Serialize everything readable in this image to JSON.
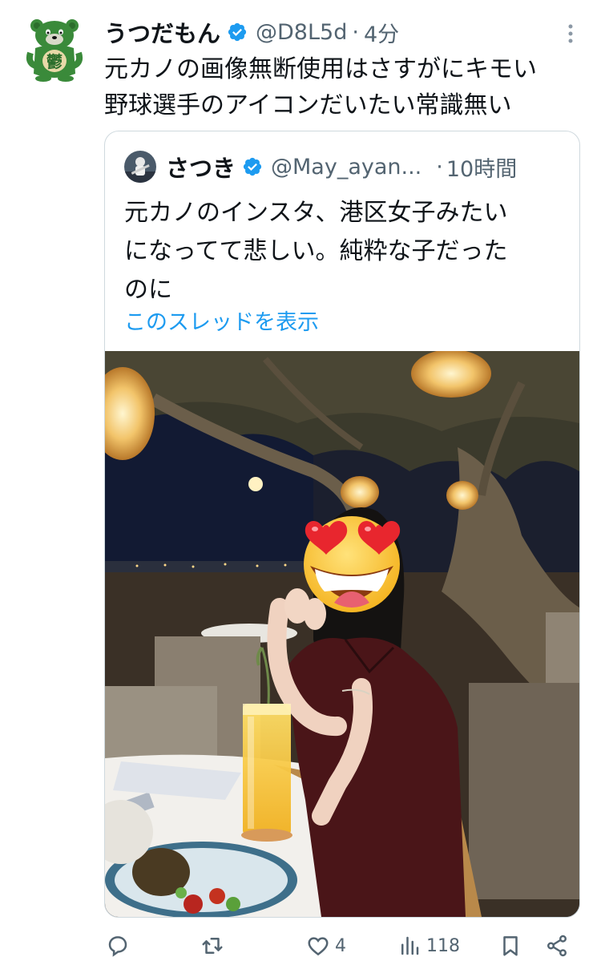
{
  "tweet": {
    "author": {
      "name": "うつだもん",
      "handle": "@D8L5d",
      "avatar_glyph": "鬱"
    },
    "time": "4分",
    "separator": "·",
    "text_lines": [
      "元カノの画像無断使用はさすがにキモい",
      "野球選手のアイコンだいたい常識無い"
    ]
  },
  "quote": {
    "author": {
      "name": "さつき",
      "handle": "@May_ayan..."
    },
    "separator": "·",
    "time": "10時間",
    "text_lines": [
      "元カノのインスタ、港区女子みたい",
      "になってて悲しい。純粋な子だった",
      "のに"
    ],
    "show_thread": "このスレッドを表示"
  },
  "actions": {
    "reply_count": "",
    "retweet_count": "",
    "like_count": "4",
    "views_count": "118"
  },
  "icons": {
    "verified": "verified-badge-icon",
    "more": "more-icon",
    "reply": "reply-icon",
    "retweet": "retweet-icon",
    "like": "heart-icon",
    "views": "views-icon",
    "bookmark": "bookmark-icon",
    "share": "share-icon"
  },
  "colors": {
    "accent": "#1d9bf0",
    "text": "#0f1419",
    "muted": "#536471",
    "border": "#cfd9de",
    "avatar_green": "#3a8a3a"
  }
}
